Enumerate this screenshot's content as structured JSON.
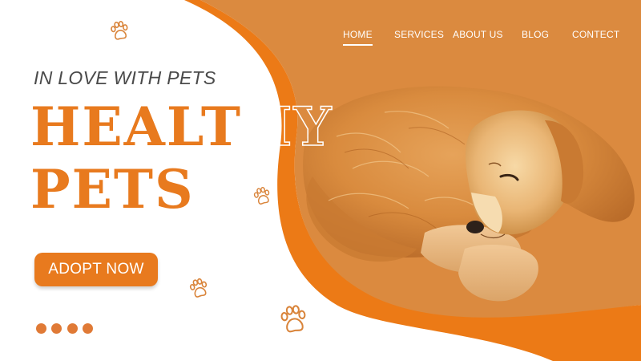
{
  "nav": {
    "items": [
      {
        "label": "HOME",
        "active": true
      },
      {
        "label": "SERVICES",
        "active": false
      },
      {
        "label": "ABOUT US",
        "active": false
      },
      {
        "label": "BLOG",
        "active": false
      },
      {
        "label": "CONTECT",
        "active": false
      }
    ]
  },
  "hero": {
    "tagline": "IN LOVE WITH PETS",
    "headline_line1_solid": "HEALT",
    "headline_line1_outline": "HY",
    "headline_line2": "PETS",
    "cta_label": "ADOPT NOW"
  },
  "carousel": {
    "dot_count": 4
  },
  "colors": {
    "accent": "#e87a1e",
    "panel": "#db8a3f",
    "text_dark": "#4a4a4a",
    "background": "#ffffff"
  },
  "icons": [
    "paw-print-icon"
  ],
  "image": {
    "subject": "golden retriever dog lying down"
  }
}
